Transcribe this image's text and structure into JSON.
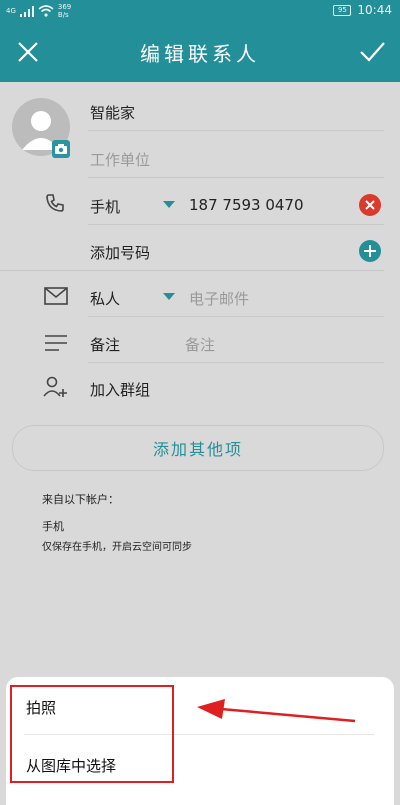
{
  "status_bar": {
    "network": "4G",
    "speed": "369",
    "speed_unit": "B/s",
    "battery": "95",
    "time": "10:44"
  },
  "header": {
    "title": "编辑联系人"
  },
  "contact": {
    "name": "智能家",
    "company_placeholder": "工作单位"
  },
  "phone": {
    "type": "手机",
    "number": "187 7593 0470",
    "add_number_label": "添加号码"
  },
  "email": {
    "type": "私人",
    "placeholder": "电子邮件"
  },
  "note": {
    "label": "备注",
    "placeholder": "备注"
  },
  "group": {
    "label": "加入群组"
  },
  "add_other_label": "添加其他项",
  "account": {
    "heading": "来自以下帐户：",
    "name": "手机",
    "desc": "仅保存在手机，开启云空间可同步"
  },
  "photo_sheet": {
    "items": [
      "拍照",
      "从图库中选择"
    ]
  },
  "colors": {
    "accent": "#238f99",
    "delete_red": "#d93a2b",
    "highlight_red": "#e02020"
  }
}
